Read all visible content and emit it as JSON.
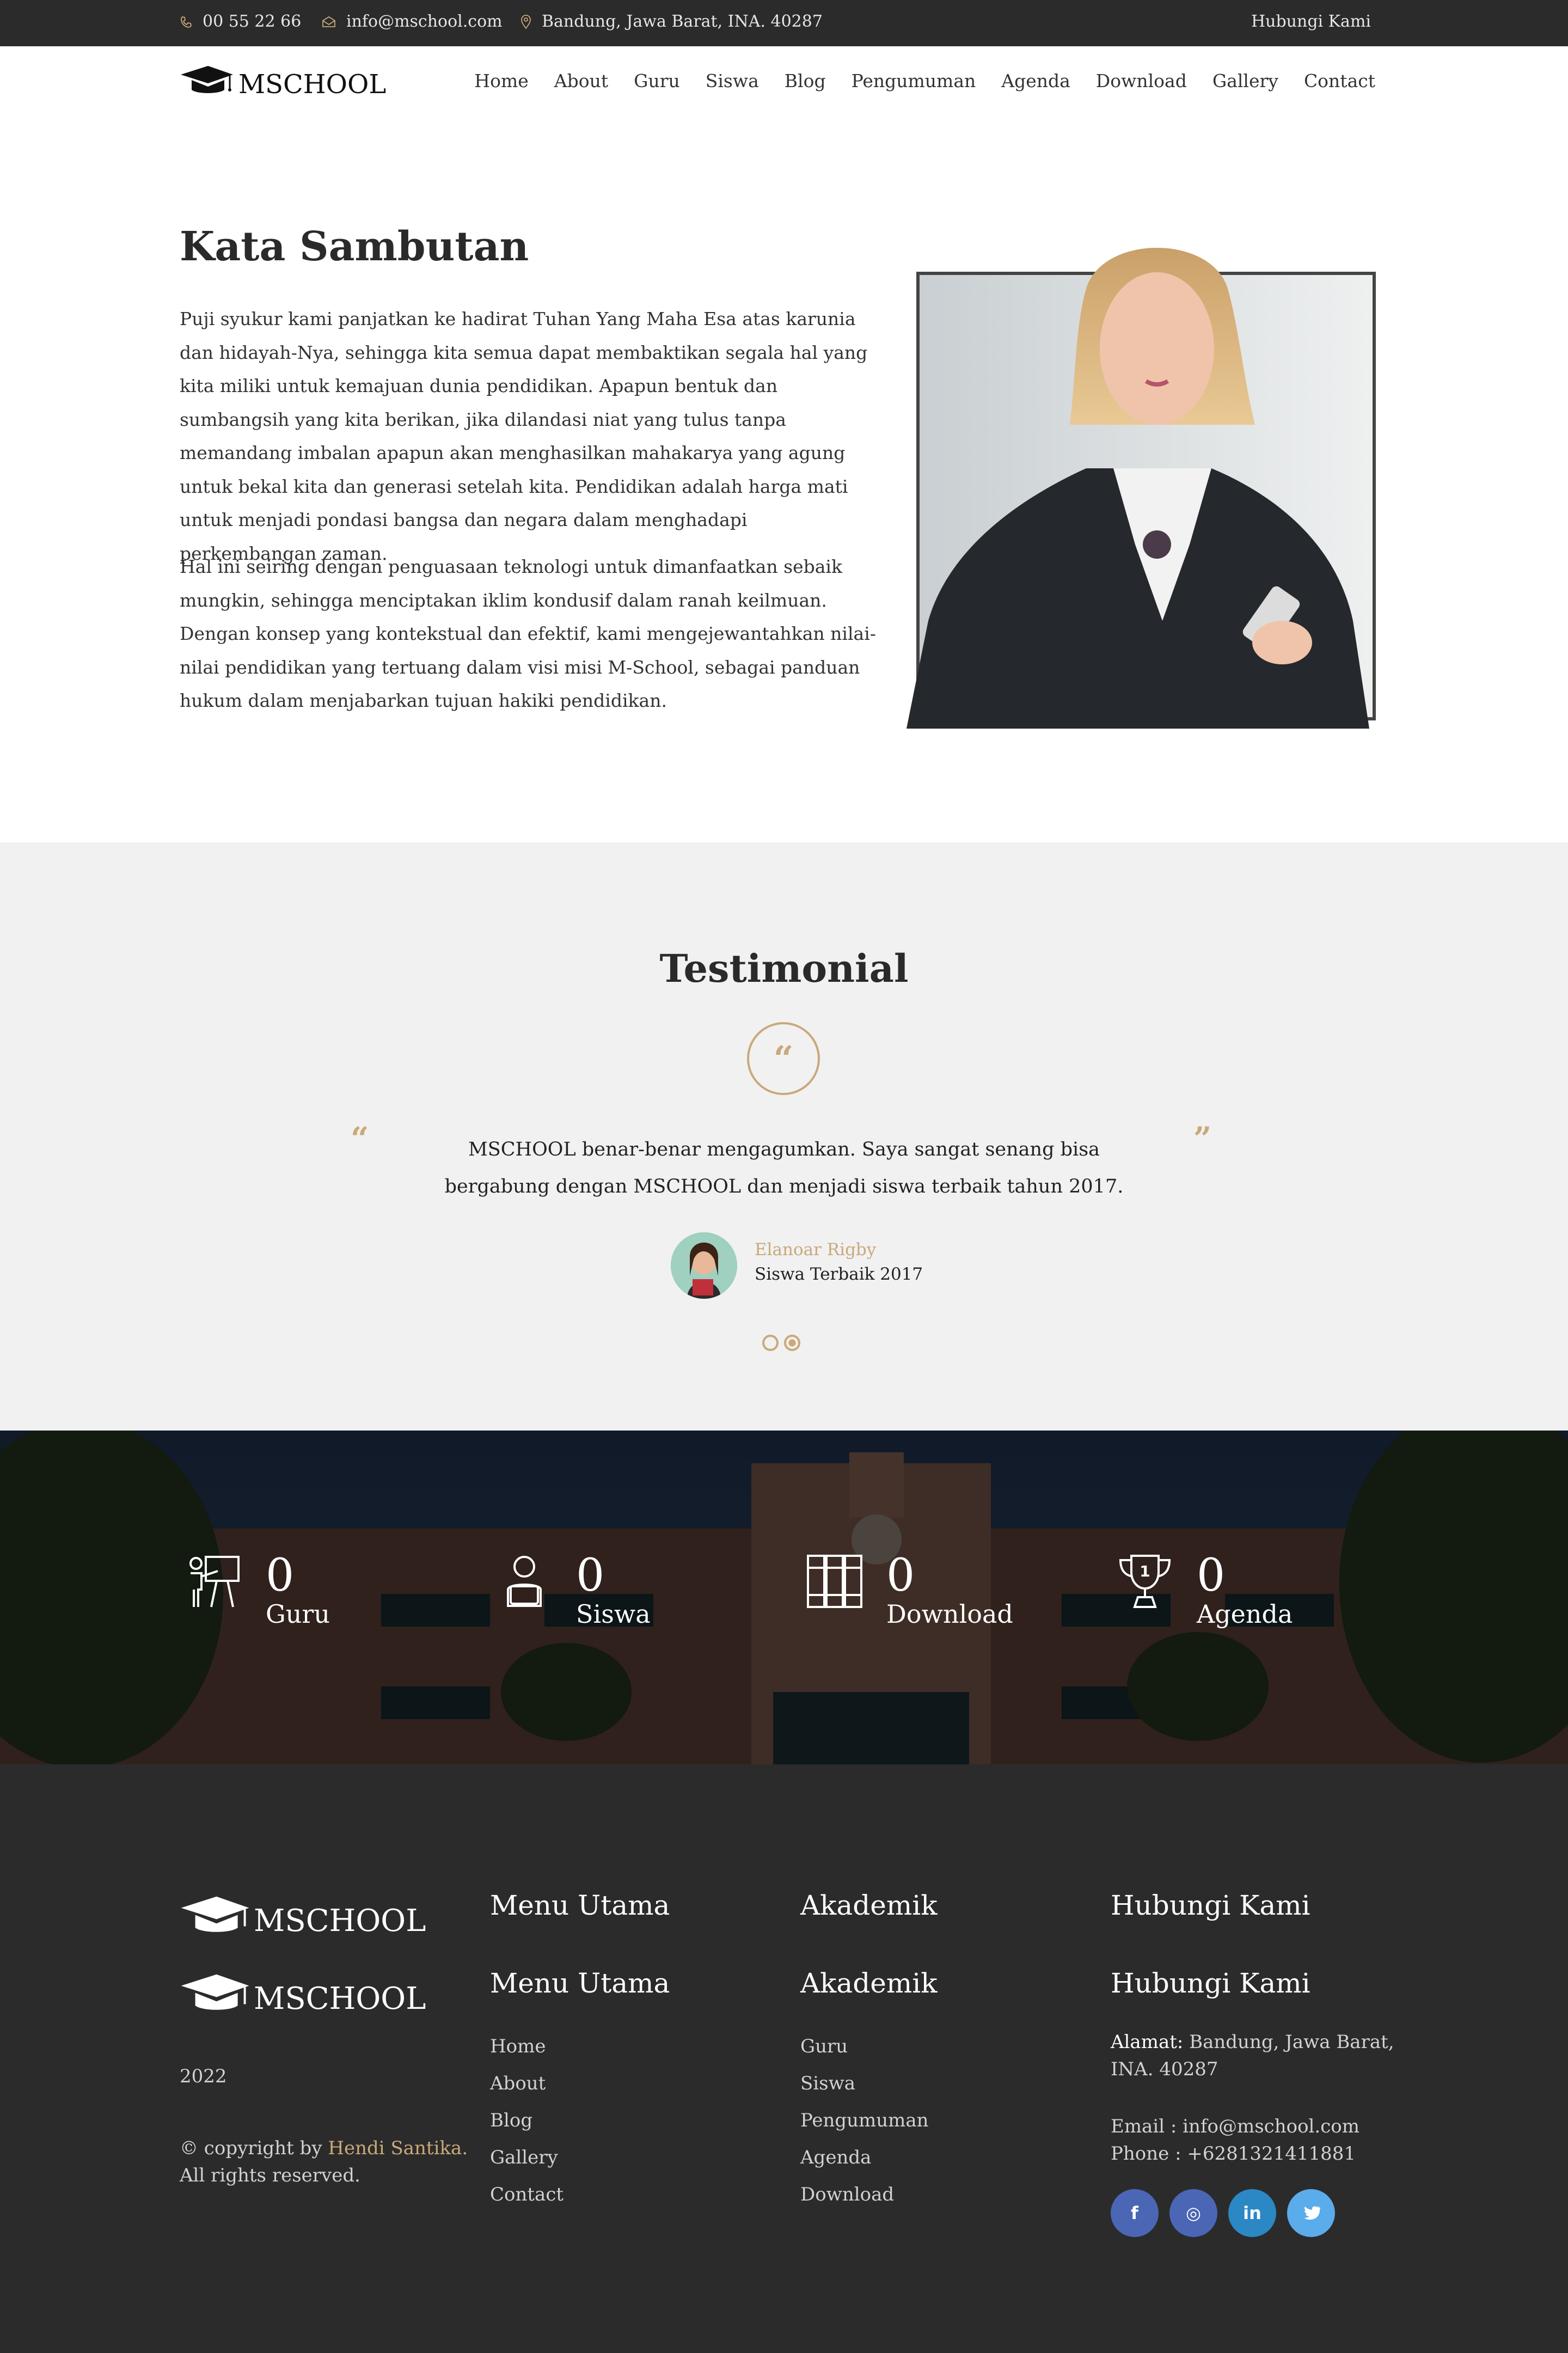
{
  "topbar": {
    "phone": "00 55 22 66",
    "email": "info@mschool.com",
    "address": "Bandung, Jawa Barat, INA. 40287",
    "contact_label": "Hubungi Kami"
  },
  "nav": {
    "logo": "MSCHOOL",
    "items": [
      "Home",
      "About",
      "Guru",
      "Siswa",
      "Blog",
      "Pengumuman",
      "Agenda",
      "Download",
      "Gallery",
      "Contact"
    ]
  },
  "sambutan": {
    "title": "Kata Sambutan",
    "paragraph1": "Puji syukur kami panjatkan ke hadirat Tuhan Yang Maha Esa atas karunia dan hidayah-Nya, sehingga kita semua dapat membaktikan segala hal yang kita miliki untuk kemajuan dunia pendidikan. Apapun bentuk dan sumbangsih yang kita berikan, jika dilandasi niat yang tulus tanpa memandang imbalan apapun akan menghasilkan mahakarya yang agung untuk bekal kita dan generasi setelah kita. Pendidikan adalah harga mati untuk menjadi pondasi bangsa dan negara dalam menghadapi perkembangan zaman.",
    "paragraph2": "Hal ini seiring dengan penguasaan teknologi untuk dimanfaatkan sebaik mungkin, sehingga menciptakan iklim kondusif dalam ranah keilmuan. Dengan konsep yang kontekstual dan efektif, kami mengejewantahkan nilai-nilai pendidikan yang tertuang dalam visi misi M-School, sebagai panduan hukum dalam menjabarkan tujuan hakiki pendidikan."
  },
  "testimonial": {
    "title": "Testimonial",
    "text": "MSCHOOL benar-benar mengagumkan. Saya sangat senang bisa bergabung dengan MSCHOOL dan menjadi siswa terbaik tahun 2017.",
    "author": "Elanoar Rigby",
    "role": "Siswa Terbaik 2017"
  },
  "stats": [
    {
      "value": "0",
      "label": "Guru",
      "icon": "teacher-icon"
    },
    {
      "value": "0",
      "label": "Siswa",
      "icon": "student-icon"
    },
    {
      "value": "0",
      "label": "Download",
      "icon": "books-icon"
    },
    {
      "value": "0",
      "label": "Agenda",
      "icon": "trophy-icon"
    }
  ],
  "footer": {
    "logo": "MSCHOOL",
    "year": "2022",
    "copyright_prefix": "© copyright by",
    "copyright_author": "Hendi Santika.",
    "rights": "All rights reserved.",
    "menu_title": "Menu Utama",
    "menu_items": [
      "Home",
      "About",
      "Blog",
      "Gallery",
      "Contact"
    ],
    "akademik_title": "Akademik",
    "akademik_items": [
      "Guru",
      "Siswa",
      "Pengumuman",
      "Agenda",
      "Download"
    ],
    "contact_title": "Hubungi Kami",
    "address_label": "Alamat:",
    "address": "Bandung, Jawa Barat,",
    "address2": "INA. 40287",
    "email": "Email : info@mschool.com",
    "phone": "Phone : +6281321411881",
    "social": [
      {
        "name": "facebook",
        "glyph": "f",
        "color": "#4a66b5"
      },
      {
        "name": "instagram",
        "glyph": "◎",
        "color": "#4a66b5"
      },
      {
        "name": "linkedin",
        "glyph": "in",
        "color": "#2b88c4"
      },
      {
        "name": "twitter",
        "glyph": "🐦",
        "color": "#5aacea"
      }
    ]
  },
  "colors": {
    "accent": "#c9a97a",
    "dark": "#2b2b2b",
    "light_bg": "#f1f1f1"
  }
}
